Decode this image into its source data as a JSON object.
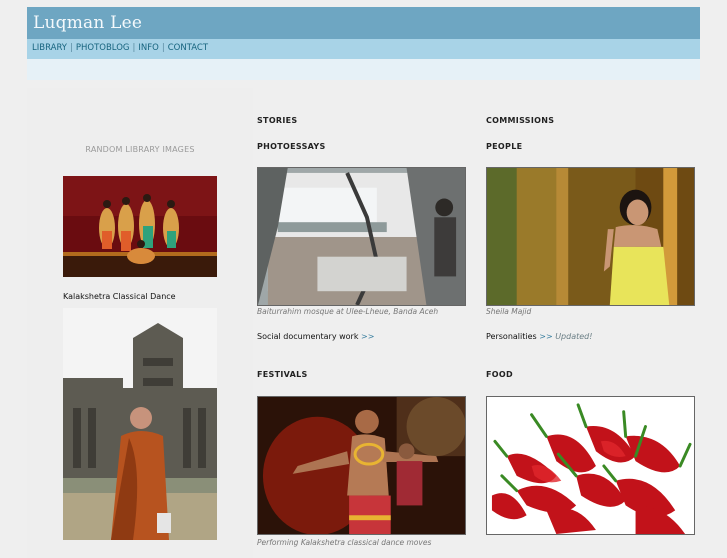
{
  "header": {
    "site_title": "Luqman Lee"
  },
  "nav": {
    "items": [
      {
        "label": "LIBRARY"
      },
      {
        "label": "PHOTOBLOG"
      },
      {
        "label": "INFO"
      },
      {
        "label": "CONTACT"
      }
    ],
    "separator": "|"
  },
  "left": {
    "heading": "RANDOM LIBRARY IMAGES",
    "image1_caption": "Kalakshetra Classical Dance"
  },
  "stories": {
    "title": "STORIES",
    "photoessays": {
      "title": "PHOTOESSAYS",
      "caption": "Baiturrahim mosque at Ulee-Lheue, Banda Aceh",
      "link_text": "Social documentary work",
      "link_arrow": ">>"
    },
    "festivals": {
      "title": "FESTIVALS",
      "caption": "Performing Kalakshetra classical dance moves"
    }
  },
  "commissions": {
    "title": "COMMISSIONS",
    "people": {
      "title": "PEOPLE",
      "caption": "Sheila Majid",
      "link_text": "Personalities",
      "link_arrow": ">>",
      "updated": "Updated!"
    },
    "food": {
      "title": "FOOD"
    }
  },
  "colors": {
    "header": "#6ea6c2",
    "nav": "#a8d3e7",
    "subbar": "#e6f1f7",
    "link": "#3a7f9f"
  }
}
